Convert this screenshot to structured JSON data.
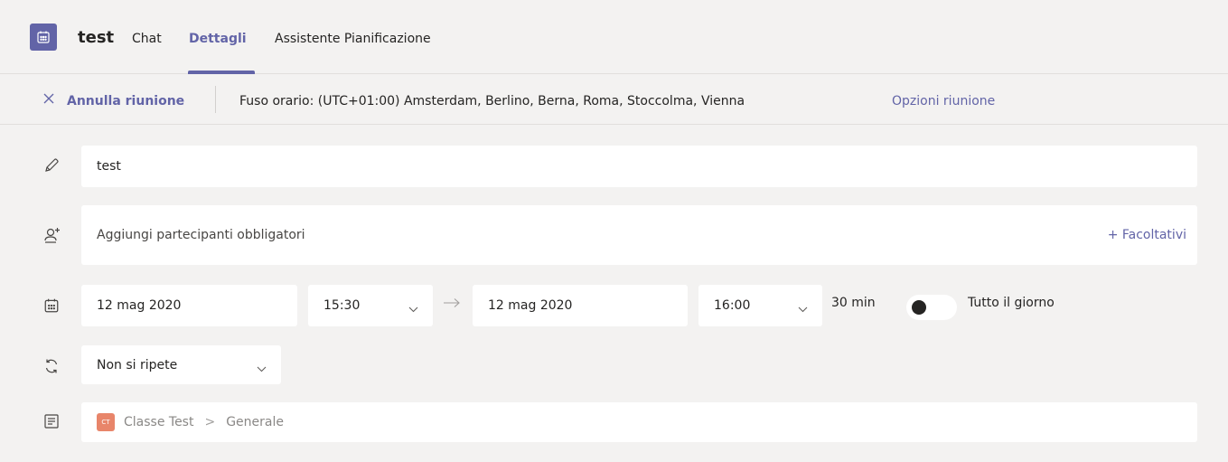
{
  "header": {
    "title": "test",
    "tabs": [
      {
        "label": "Chat",
        "active": false
      },
      {
        "label": "Dettagli",
        "active": true
      },
      {
        "label": "Assistente Pianificazione",
        "active": false
      }
    ],
    "app_icon": "calendar-icon"
  },
  "toolbar": {
    "cancel_label": "Annulla riunione",
    "timezone": "Fuso orario: (UTC+01:00) Amsterdam, Berlino, Berna, Roma, Stoccolma, Vienna",
    "options_label": "Opzioni riunione"
  },
  "form": {
    "title_value": "test",
    "attendees_placeholder": "Aggiungi partecipanti obbligatori",
    "optional_label": "+ Facoltativi",
    "start_date": "12 mag 2020",
    "start_time": "15:30",
    "end_date": "12 mag 2020",
    "end_time": "16:00",
    "duration": "30 min",
    "all_day_label": "Tutto il giorno",
    "all_day_on": false,
    "repeat": "Non si ripete",
    "channel_badge": "CT",
    "channel_team": "Classe Test",
    "channel_separator": ">",
    "channel_name": "Generale"
  },
  "colors": {
    "accent": "#6264a7",
    "background": "#f3f2f1",
    "field": "#ffffff",
    "channel_badge": "#e8856a"
  }
}
